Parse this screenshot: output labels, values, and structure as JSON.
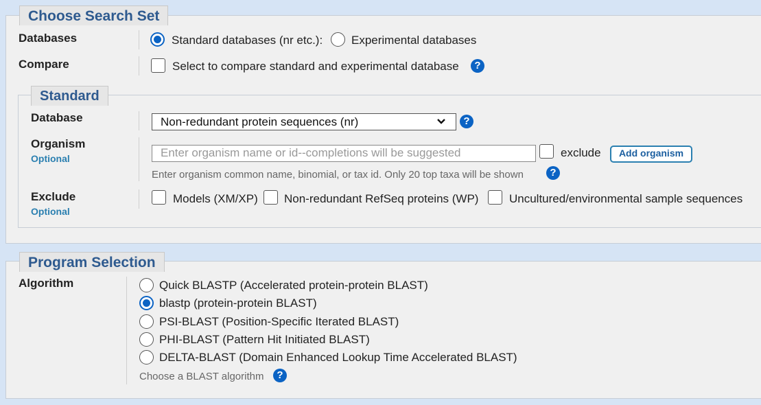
{
  "search_set": {
    "title": "Choose Search Set",
    "databases_label": "Databases",
    "db_standard_label": "Standard databases (nr etc.):",
    "db_experimental_label": "Experimental databases",
    "compare_label": "Compare",
    "compare_checkbox_label": "Select to compare standard and experimental database",
    "help_glyph": "?"
  },
  "standard": {
    "title": "Standard",
    "database_label": "Database",
    "database_value": "Non-redundant protein sequences (nr)",
    "organism_label": "Organism",
    "optional_label": "Optional",
    "organism_placeholder": "Enter organism name or id--completions will be suggested",
    "exclude_checkbox_label": "exclude",
    "add_organism_label": "Add organism",
    "organism_hint": "Enter organism common name, binomial, or tax id. Only 20 top taxa will be shown",
    "exclude_label": "Exclude",
    "exclude_options": [
      "Models (XM/XP)",
      "Non-redundant RefSeq proteins (WP)",
      "Uncultured/environmental sample sequences"
    ]
  },
  "program": {
    "title": "Program Selection",
    "algorithm_label": "Algorithm",
    "algorithms": [
      "Quick BLASTP (Accelerated protein-protein BLAST)",
      "blastp (protein-protein BLAST)",
      "PSI-BLAST (Position-Specific Iterated BLAST)",
      "PHI-BLAST (Pattern Hit Initiated BLAST)",
      "DELTA-BLAST (Domain Enhanced Lookup Time Accelerated BLAST)"
    ],
    "selected_algorithm": "blastp (protein-protein BLAST)",
    "hint": "Choose a BLAST algorithm"
  }
}
